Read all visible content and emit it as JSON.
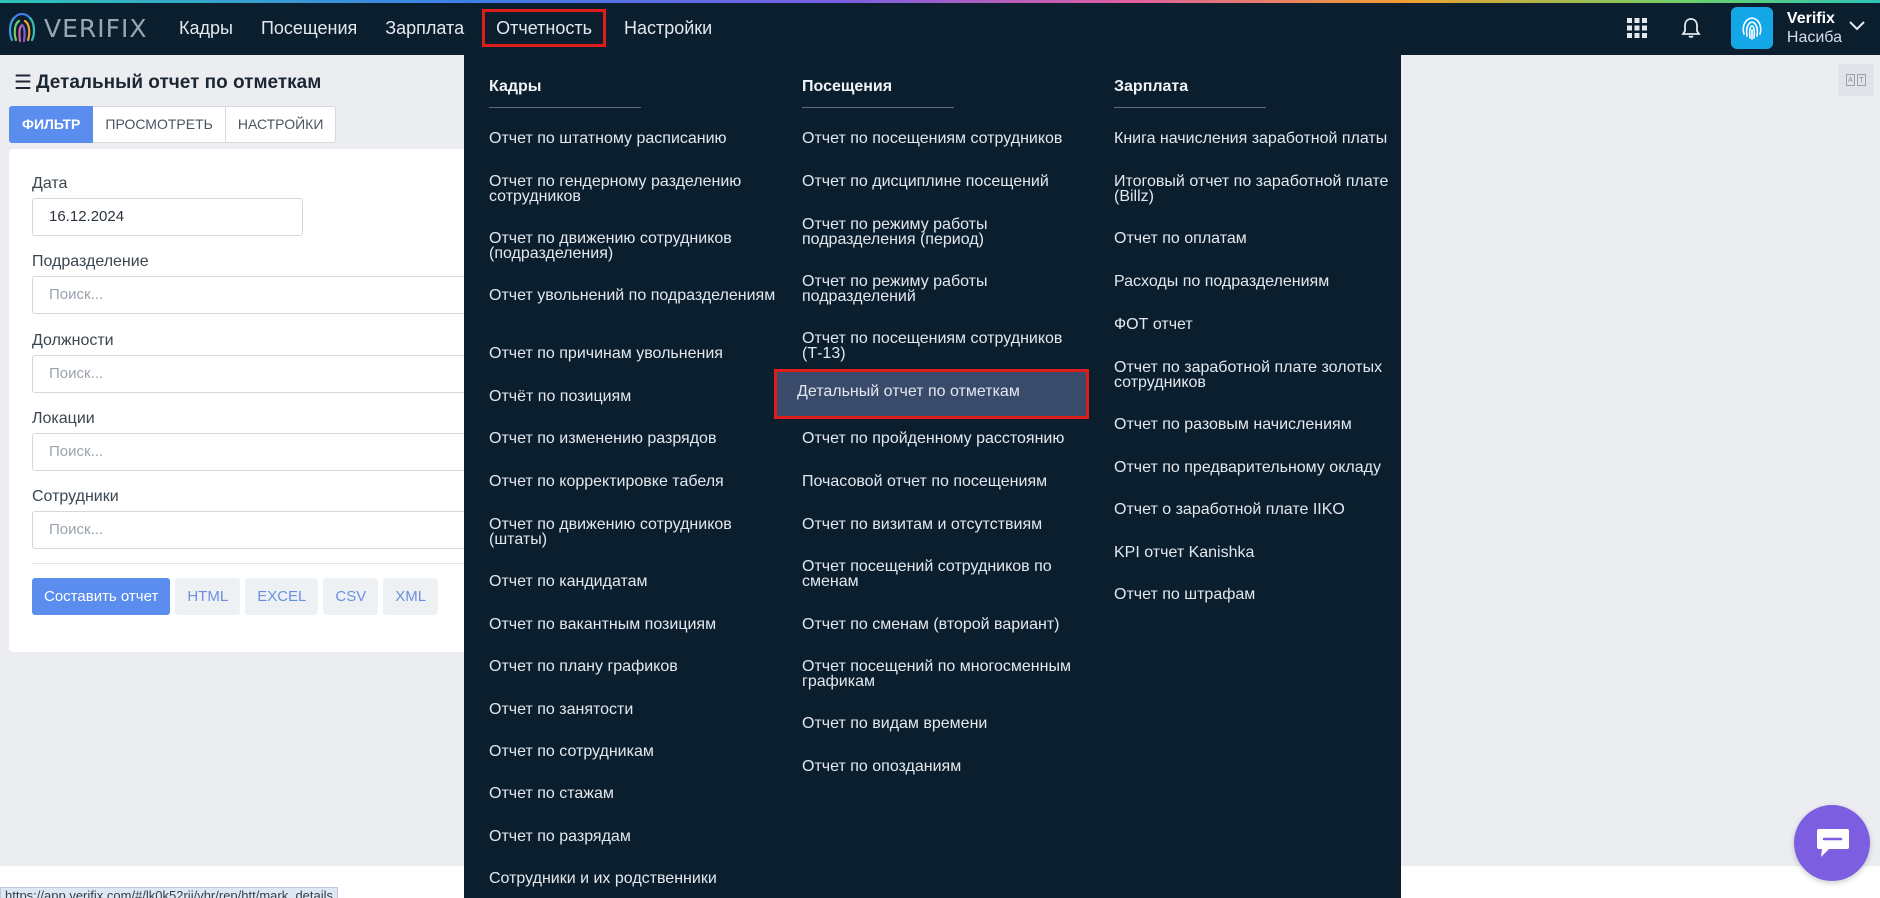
{
  "app": {
    "logo_text": "VERIFIX",
    "nav": [
      "Кадры",
      "Посещения",
      "Зарплата",
      "Отчетность",
      "Настройки"
    ],
    "active_nav": "Отчетность",
    "user_name": "Verifix",
    "user_sub": "Насиба"
  },
  "page": {
    "title": "Детальный отчет по отметкам",
    "tabs": [
      "ФИЛЬТР",
      "ПРОСМОТРЕТЬ",
      "НАСТРОЙКИ"
    ],
    "filter": {
      "date_label": "Дата",
      "date_value": "16.12.2024",
      "division_label": "Подразделение",
      "positions_label": "Должности",
      "locations_label": "Локации",
      "employees_label": "Сотрудники",
      "search_placeholder": "Поиск..."
    },
    "buttons": {
      "build": "Составить отчет",
      "formats": [
        "HTML",
        "EXCEL",
        "CSV",
        "XML"
      ]
    }
  },
  "menu": {
    "columns": [
      {
        "title": "Кадры",
        "items": [
          "Отчет по штатному расписанию",
          "Отчет по гендерному разделению сотрудников",
          "Отчет по движению сотрудников (подразделения)",
          "Отчет увольнений по подразделениям",
          "Отчет по причинам увольнения",
          "Отчёт по позициям",
          "Отчет по изменению разрядов",
          "Отчет по корректировке табеля",
          "Отчет по движению сотрудников (штаты)",
          "Отчет по кандидатам",
          "Отчет по вакантным позициям",
          "Отчет по плану графиков",
          "Отчет по занятости",
          "Отчет по сотрудникам",
          "Отчет по стажам",
          "Отчет по разрядам",
          "Сотрудники и их родственники"
        ]
      },
      {
        "title": "Посещения",
        "items": [
          "Отчет по посещениям сотрудников",
          "Отчет по дисциплине посещений",
          "Отчет по режиму работы подразделения (период)",
          "Отчет по режиму работы подразделений",
          "Отчет по посещениям сотрудников (Т-13)",
          "Детальный отчет по отметкам",
          "Отчет по пройденному расстоянию",
          "Почасовой отчет по посещениям",
          "Отчет по визитам и отсутствиям",
          "Отчет посещений сотрудников по сменам",
          "Отчет по сменам (второй вариант)",
          "Отчет посещений по многосменным графикам",
          "Отчет по видам времени",
          "Отчет по опозданиям"
        ]
      },
      {
        "title": "Зарплата",
        "items": [
          "Книга начисления заработной платы",
          "Итоговый отчет по заработной плате (Billz)",
          "Отчет по оплатам",
          "Расходы по подразделениям",
          "ФОТ отчет",
          "Отчет по заработной плате золотых сотрудников",
          "Отчет по разовым начислениям",
          "Отчет по предварительному окладу",
          "Отчет о заработной плате IIKO",
          "KPI отчет Kanishka",
          "Отчет по штрафам"
        ]
      }
    ],
    "highlighted_item": "Детальный отчет по отметкам"
  },
  "status_bar": {
    "url": "https://app.verifix.com/#/lk0k52rij/vhr/rep/htt/mark_details"
  },
  "colors": {
    "nav_bg": "#0b1e2d",
    "accent": "#5b8def",
    "highlight_border": "#e01b1b",
    "chat": "#7b5fe0"
  }
}
